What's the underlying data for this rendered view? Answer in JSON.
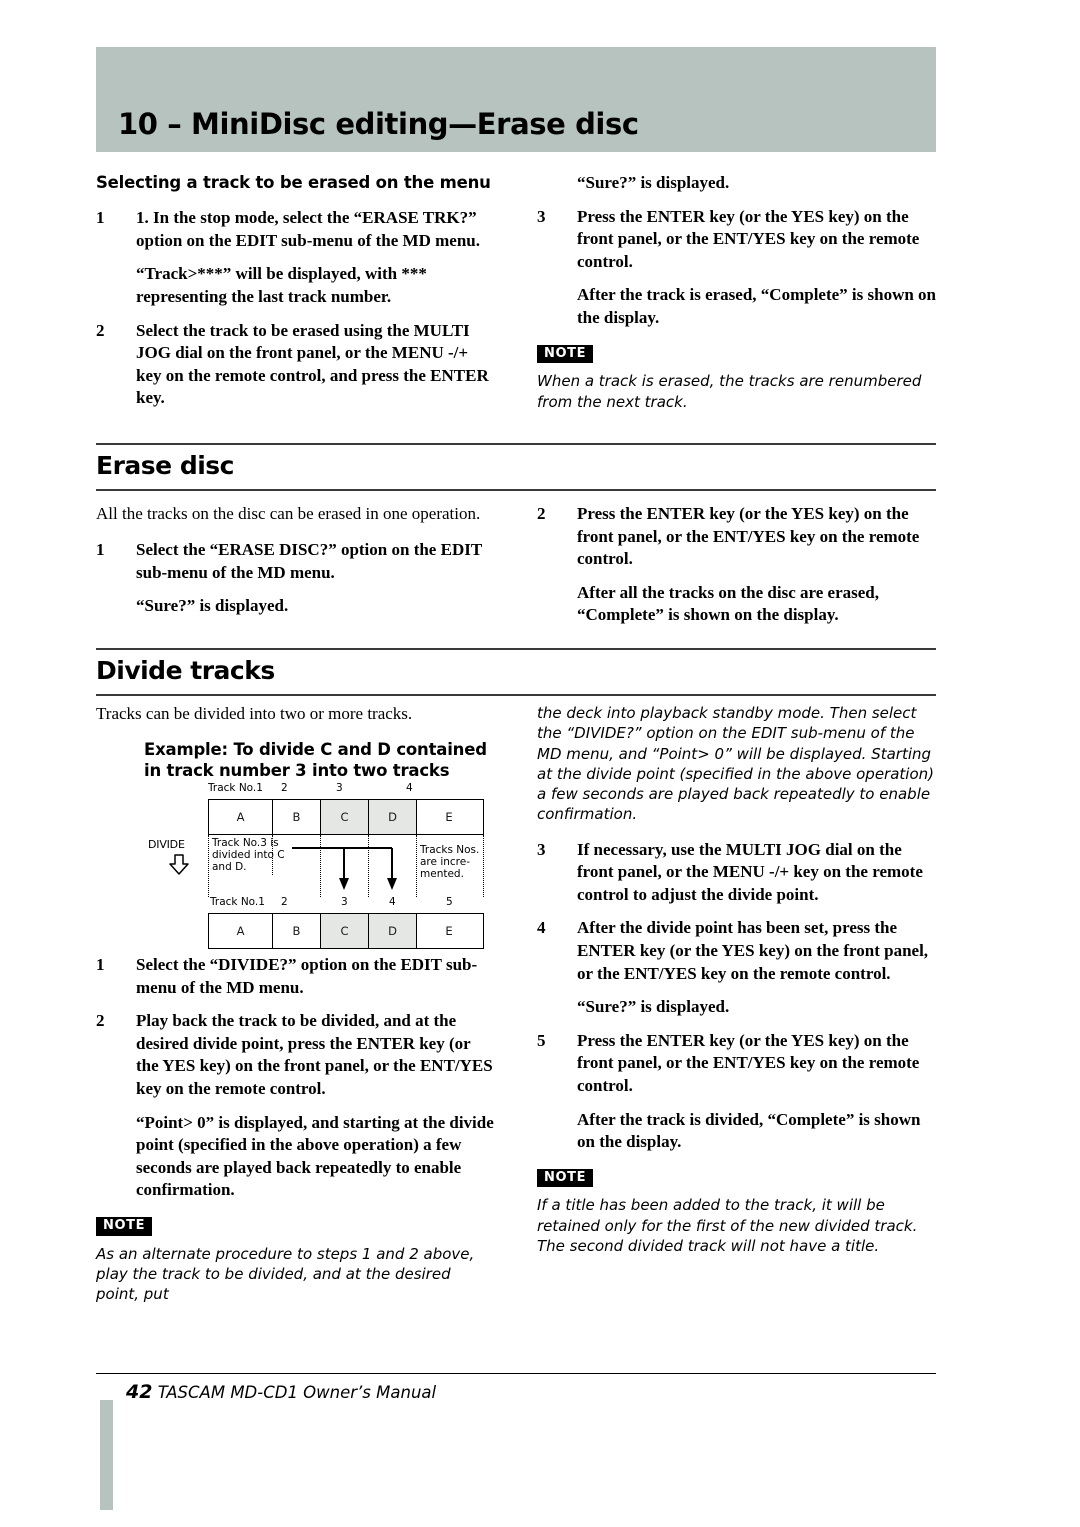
{
  "header": {
    "title": "10 – MiniDisc editing—Erase disc",
    "band_color": "#b6c3bf"
  },
  "left_column": {
    "subhead": "Selecting a track to be erased on the menu",
    "step1_num": "1",
    "step1_text": "1. In the stop mode, select the “ERASE TRK?” option on the EDIT sub-menu of the MD menu.",
    "step1_note": "“Track>***” will be displayed, with *** representing the last track number.",
    "step2_num": "2",
    "step2_text": "Select the track to be erased using the MULTI JOG dial on the front panel, or the MENU -/+ key on the remote control, and press the ENTER key."
  },
  "right_column": {
    "sure_displayed": "“Sure?” is displayed.",
    "step3_num": "3",
    "step3_text": "Press the ENTER key (or the YES key) on the front panel, or the ENT/YES key on the remote control.",
    "step3_note": "After the track is erased, “Complete” is shown on the display.",
    "note_tag": "NOTE",
    "note_text": "When a track is erased, the tracks are renumbered from the next track."
  },
  "erase_disc": {
    "heading": "Erase disc",
    "intro": "All the tracks on the disc can be erased in one operation.",
    "step1_num": "1",
    "step1_text": "Select the “ERASE DISC?” option on the EDIT sub-menu of the MD menu.",
    "step1_note": "“Sure?” is displayed.",
    "step2_num": "2",
    "step2_text": "Press the ENTER key (or the YES key) on the front panel, or the ENT/YES key on the remote control.",
    "step2_note": "After all the tracks on the disc are erased, “Complete” is shown on the display."
  },
  "divide_tracks": {
    "heading": "Divide tracks",
    "intro": "Tracks can be divided into two or more tracks.",
    "example_title": "Example: To divide C and D contained in track number 3 into two tracks",
    "step1_num": "1",
    "step1_text": "Select the “DIVIDE?” option on the EDIT sub-menu of the MD menu.",
    "step2_num": "2",
    "step2_text": "Play back the track to be divided, and at the desired divide point, press the ENTER key (or the YES key) on the front panel, or the ENT/YES key on the remote control.",
    "step2_note": "“Point> 0” is displayed, and starting at the divide point (specified in the above operation) a few seconds are played back repeatedly to enable confirmation.",
    "note_tag": "NOTE",
    "note_text": "As an alternate procedure to steps 1 and 2 above, play the track to be divided, and at the desired point, put",
    "note_text_cont": "the deck into playback standby mode. Then select the “DIVIDE?” option on the EDIT sub-menu of the MD menu, and “Point> 0” will be displayed. Starting at the divide point (specified in the above operation) a few seconds are played back repeatedly to enable confirmation.",
    "step3_num": "3",
    "step3_text": "If necessary, use the MULTI JOG dial on the front panel, or the MENU -/+ key on the remote control to adjust the divide point.",
    "step4_num": "4",
    "step4_text": "After the divide point has been set, press the ENTER key (or the YES key) on the front panel, or the ENT/YES key on the remote control.",
    "step4_note": "“Sure?” is displayed.",
    "step5_num": "5",
    "step5_text": "Press the ENTER key (or the YES key) on the front panel, or the ENT/YES key on the remote control.",
    "step5_note": "After the track is divided, “Complete” is shown on the display.",
    "note2_tag": "NOTE",
    "note2_text": "If a title has been added to the track, it will be retained only for the first of the new divided track. The second divided track will not have a title."
  },
  "diagram": {
    "divide_label": "DIVIDE",
    "top_labels": [
      "Track No.1",
      "2",
      "3",
      "4"
    ],
    "top_cells": [
      "A",
      "B",
      "C",
      "D",
      "E"
    ],
    "bottom_labels": [
      "Track No.1",
      "2",
      "3",
      "4",
      "5"
    ],
    "bottom_cells": [
      "A",
      "B",
      "C",
      "D",
      "E"
    ],
    "annotation_left": "Track No.3 is divided into C and D.",
    "annotation_right": "Tracks Nos. are incremented.",
    "shaded_color": "#e4e7e4"
  },
  "footer": {
    "page_number": "42",
    "manual_title": "TASCAM MD-CD1 Owner’s Manual",
    "bar_color": "#b6c3bf"
  }
}
